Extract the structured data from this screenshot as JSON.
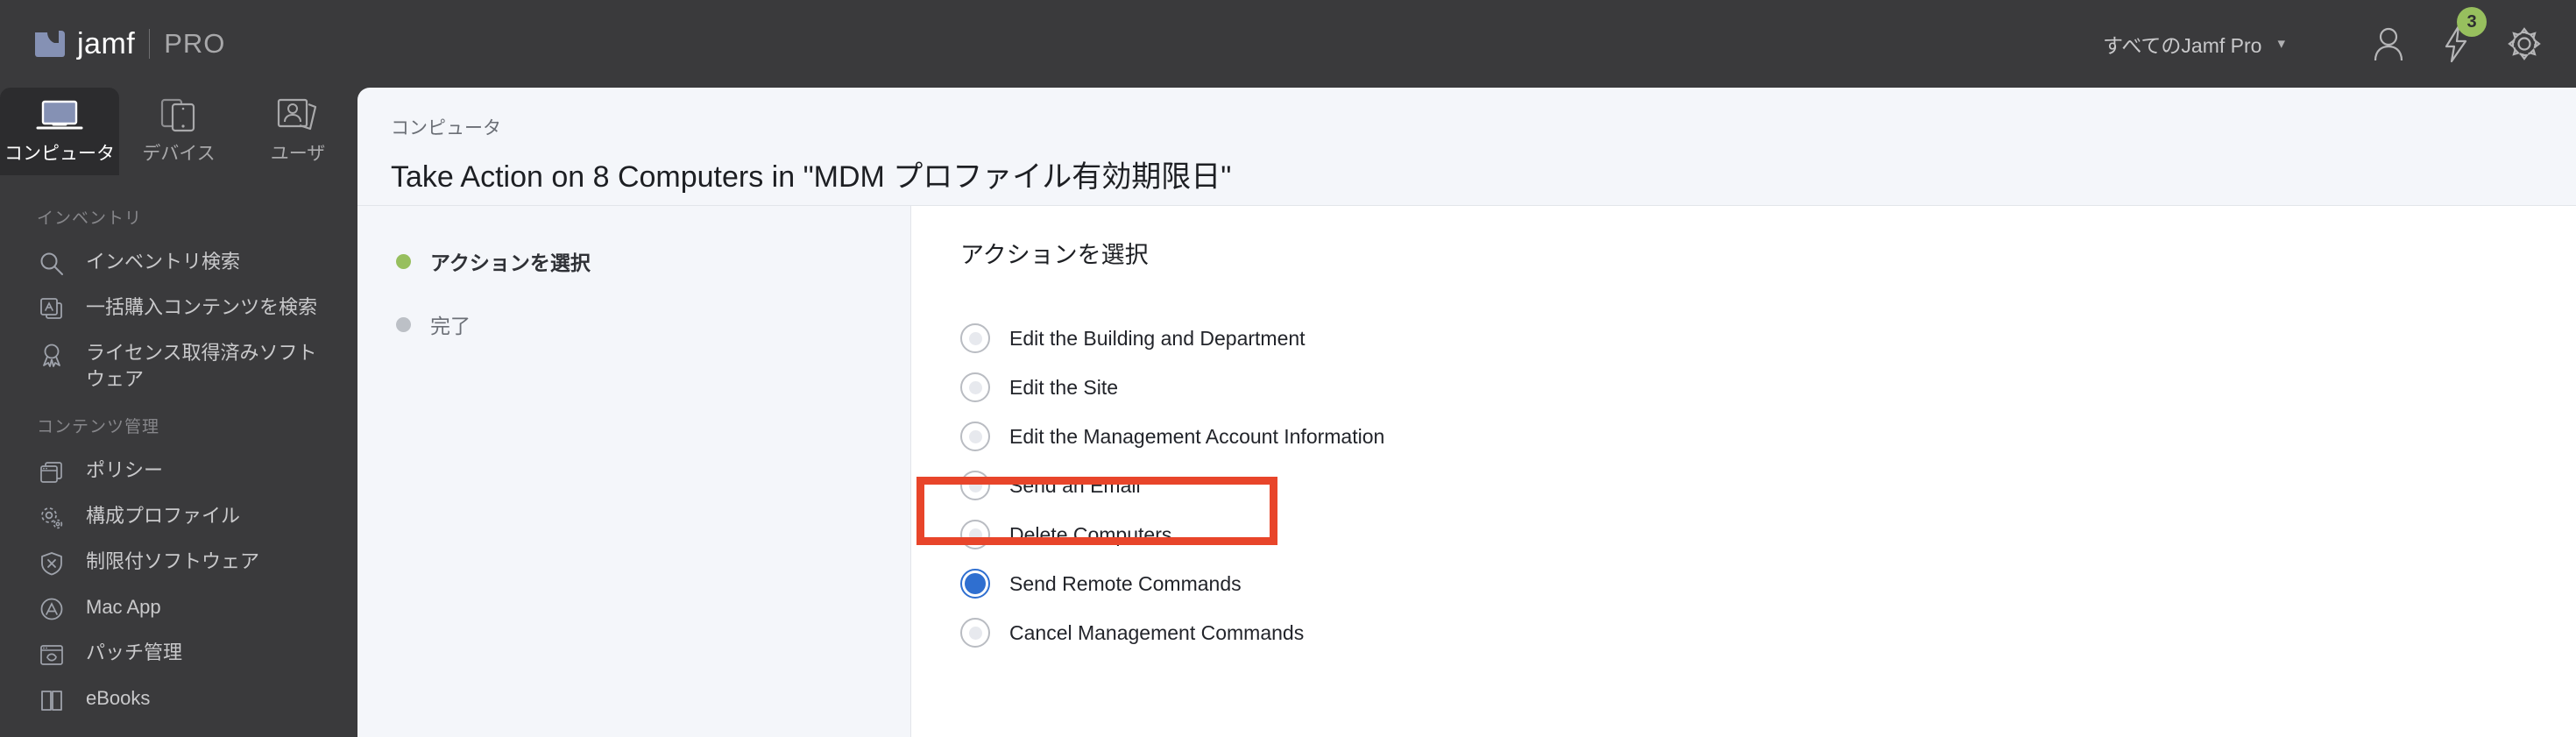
{
  "header": {
    "brand_name": "jamf",
    "brand_suffix": "PRO",
    "scope_selector": "すべてのJamf Pro",
    "scope_chevron": "chevron-down-icon",
    "account_icon": "user-icon",
    "activity_icon": "lightning-bolt-icon",
    "activity_badge": "3",
    "settings_icon": "gear-icon"
  },
  "nav_tabs": [
    {
      "label": "コンピュータ",
      "icon": "laptop-icon",
      "active": true
    },
    {
      "label": "デバイス",
      "icon": "mobile-devices-icon",
      "active": false
    },
    {
      "label": "ユーザ",
      "icon": "users-cards-icon",
      "active": false
    }
  ],
  "sidebar": {
    "groups": [
      {
        "title": "インベントリ",
        "items": [
          {
            "label": "インベントリ検索",
            "icon": "search-icon"
          },
          {
            "label": "一括購入コンテンツを検索",
            "icon": "app-store-stack-icon"
          },
          {
            "label": "ライセンス取得済みソフトウェア",
            "icon": "award-ribbon-icon"
          }
        ]
      },
      {
        "title": "コンテンツ管理",
        "items": [
          {
            "label": "ポリシー",
            "icon": "policies-window-icon"
          },
          {
            "label": "構成プロファイル",
            "icon": "gears-icon"
          },
          {
            "label": "制限付ソフトウェア",
            "icon": "shield-x-icon"
          },
          {
            "label": "Mac App",
            "icon": "app-store-circle-icon"
          },
          {
            "label": "パッチ管理",
            "icon": "patch-refresh-icon"
          },
          {
            "label": "eBooks",
            "icon": "book-icon"
          }
        ]
      }
    ]
  },
  "main": {
    "breadcrumb": "コンピュータ",
    "page_title": "Take Action on 8 Computers in \"MDM プロファイル有効期限日\"",
    "steps": [
      {
        "label": "アクションを選択",
        "state": "current"
      },
      {
        "label": "完了",
        "state": "pending"
      }
    ],
    "panel_title": "アクションを選択",
    "options": [
      {
        "label": "Edit the Building and Department",
        "selected": false
      },
      {
        "label": "Edit the Site",
        "selected": false
      },
      {
        "label": "Edit the Management Account Information",
        "selected": false
      },
      {
        "label": "Send an Email",
        "selected": false
      },
      {
        "label": "Delete Computers",
        "selected": false
      },
      {
        "label": "Send Remote Commands",
        "selected": true
      },
      {
        "label": "Cancel Management Commands",
        "selected": false
      }
    ],
    "highlight": {
      "target_label": "Send Remote Commands",
      "color": "#e8452a"
    }
  },
  "colors": {
    "chrome": "#3a3a3c",
    "chrome_active_tab": "#2c2c2e",
    "page_bg": "#f4f6fa",
    "panel_bg": "#ffffff",
    "accent_blue": "#2f6fd0",
    "accent_green": "#97bf5e",
    "brand_blue": "#8591b4",
    "annotation_red": "#e8452a"
  }
}
